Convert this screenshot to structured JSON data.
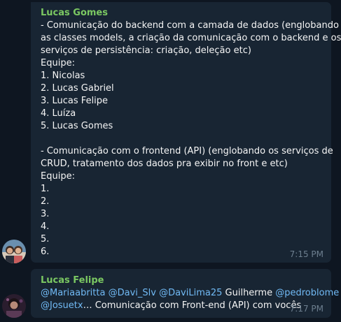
{
  "messages": [
    {
      "sender": "Lucas Gomes",
      "lines": [
        "- Comunicação do backend com a camada de dados (englobando",
        "as  classes models, a criação da comunicação com o backend e os",
        "serviços de persistência: criação, deleção etc)",
        "Equipe:",
        "1. Nicolas",
        "2. Lucas Gabriel",
        "3. Lucas Felipe",
        "4. Luíza",
        "5. Lucas Gomes",
        "",
        "- Comunicação com o frontend (API) (englobando os serviços de",
        "CRUD, tratamento dos dados pra exibir no front e etc)",
        "Equipe:",
        "1.",
        "2.",
        "3.",
        "4.",
        "5.",
        "6."
      ],
      "time": "7:15 PM"
    },
    {
      "sender": "Lucas Felipe",
      "line1": {
        "m1": "@Mariaabritta",
        "m2": "@Davi_Slv",
        "m3": "@DaviLima25",
        "plain": "Guilherme",
        "m4": "@pedroblome"
      },
      "line2": {
        "m5": "@Josuetx",
        "rest": "… Comunicação com Front-end (API) com vocês"
      },
      "time": "7:17 PM"
    }
  ],
  "colors": {
    "background": "#0e1621",
    "bubble": "#182533",
    "sender_name": "#7bc862",
    "mention": "#71baf5",
    "timestamp": "#6d7f8f"
  }
}
